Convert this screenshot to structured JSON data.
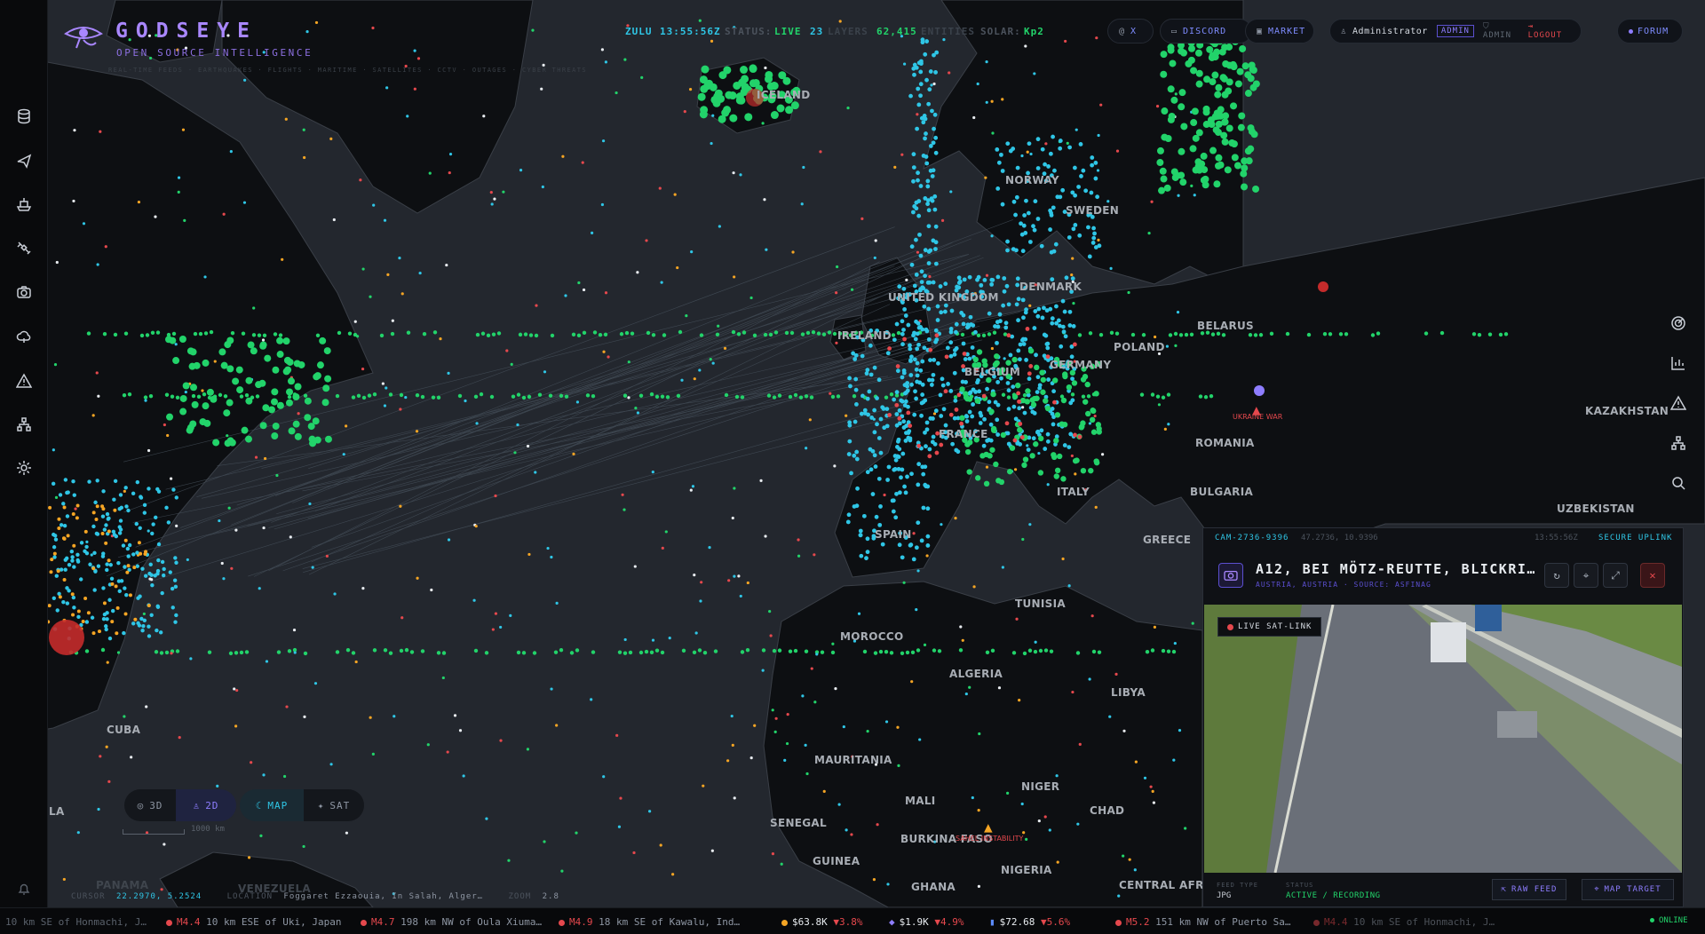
{
  "app": {
    "title": "GODSEYE",
    "subtitle": "OPEN SOURCE INTELLIGENCE",
    "tagline": "REAL-TIME FEEDS · EARTHQUAKES · FLIGHTS · MARITIME · SATELLITES · CCTV · OUTAGES · CYBER THREATS"
  },
  "status_bar": {
    "zulu_label": "ZULU",
    "zulu_time": "13:55:56Z",
    "status_label": "STATUS:",
    "status_value": "LIVE",
    "layers_count": "23",
    "layers_label": "LAYERS",
    "entities_count": "62,415",
    "entities_label": "ENTITIES",
    "solar_label": "SOLAR:",
    "solar_value": "Kp2"
  },
  "top_nav": {
    "x_label": "X",
    "discord_label": "DISCORD",
    "market_label": "MARKET",
    "user_name": "Administrator",
    "role_badge": "ADMIN",
    "admin_label": "ADMIN",
    "logout_label": "LOGOUT",
    "forum_label": "FORUM"
  },
  "left_rail": {
    "icons": [
      "database-icon",
      "plane-icon",
      "ship-icon",
      "satellite-icon",
      "camera-icon",
      "cloud-icon",
      "warning-icon",
      "network-icon",
      "gear-icon",
      "bell-icon"
    ]
  },
  "right_rail": {
    "icons": [
      "radar-icon",
      "bar-chart-icon",
      "warning-icon",
      "network-icon",
      "search-icon"
    ]
  },
  "map": {
    "country_labels": [
      "ICELAND",
      "NORWAY",
      "SWEDEN",
      "DENMARK",
      "UNITED KINGDOM",
      "IRELAND",
      "BELARUS",
      "POLAND",
      "GERMANY",
      "BELGIUM",
      "FRANCE",
      "ROMANIA",
      "ITALY",
      "BULGARIA",
      "SPAIN",
      "GREECE",
      "TUNISIA",
      "MOROCCO",
      "ALGERIA",
      "LIBYA",
      "MAURITANIA",
      "MALI",
      "NIGER",
      "CHAD",
      "SENEGAL",
      "BURKINA FASO",
      "GUINEA",
      "NIGERIA",
      "GHANA",
      "CENTRAL AFRICAN",
      "CUBA",
      "PANAMA",
      "VENEZUELA",
      "KAZAKHSTAN",
      "UZBEKISTAN",
      "LA"
    ],
    "alerts": [
      {
        "label": "UKRAINE WAR",
        "color": "#e5484d"
      },
      {
        "label": "SAHEL INSTABILITY",
        "color": "#e5484d"
      }
    ],
    "colors": {
      "ocean": "#23272e",
      "land": "#0d0f12",
      "aircraft": "#2fc6e6",
      "vessel": "#22d36a",
      "incident": "#e5484d"
    }
  },
  "view_controls": {
    "mode_3d": "3D",
    "mode_2d": "2D",
    "map_style": "MAP",
    "sat_style": "SAT",
    "scale_label": "1000 km"
  },
  "cursor_bar": {
    "cursor_label": "CURSOR",
    "cursor_value": "22.2970, 5.2524",
    "location_label": "LOCATION",
    "location_value": "Foggaret Ezzaouia, In Salah, Alger…",
    "zoom_label": "ZOOM",
    "zoom_value": "2.8"
  },
  "camera": {
    "id": "CAM-2736-9396",
    "coords": "47.2736, 10.9396",
    "time": "13:55:56Z",
    "uplink": "SECURE UPLINK",
    "title": "A12, BEI MÖTZ-REUTTE, BLICKRI…",
    "subtitle": "AUSTRIA, AUSTRIA · SOURCE: ASFINAG",
    "live_badge": "LIVE SAT-LINK",
    "feed_type_label": "FEED TYPE",
    "feed_type_value": "JPG",
    "status_label": "STATUS",
    "status_value": "ACTIVE / RECORDING",
    "raw_feed_label": "RAW FEED",
    "map_target_label": "MAP TARGET"
  },
  "ticker": {
    "items": [
      {
        "mag": "",
        "text": "10 km SE of Honmachi, J…",
        "color": "#6b7280"
      },
      {
        "mag": "M4.4",
        "text": "10 km ESE of Uki, Japan",
        "color": "#e5484d"
      },
      {
        "mag": "M4.7",
        "text": "198 km NW of Oula Xiuma…",
        "color": "#e5484d"
      },
      {
        "mag": "M4.9",
        "text": "18 km SE of Kawalu, Ind…",
        "color": "#e5484d"
      },
      {
        "mag": "$63.8K",
        "text": "▼3.8%",
        "color": "#f5a524"
      },
      {
        "mag": "$1.9K",
        "text": "▼4.9%",
        "color": "#8e7dff"
      },
      {
        "mag": "$72.68",
        "text": "▼5.6%",
        "color": "#5b8cff"
      },
      {
        "mag": "M5.2",
        "text": "151 km NW of Puerto Sa…",
        "color": "#e5484d"
      },
      {
        "mag": "M4.4",
        "text": "10 km SE of Honmachi, J…",
        "color": "#e5484d"
      }
    ],
    "online_label": "ONLINE"
  }
}
